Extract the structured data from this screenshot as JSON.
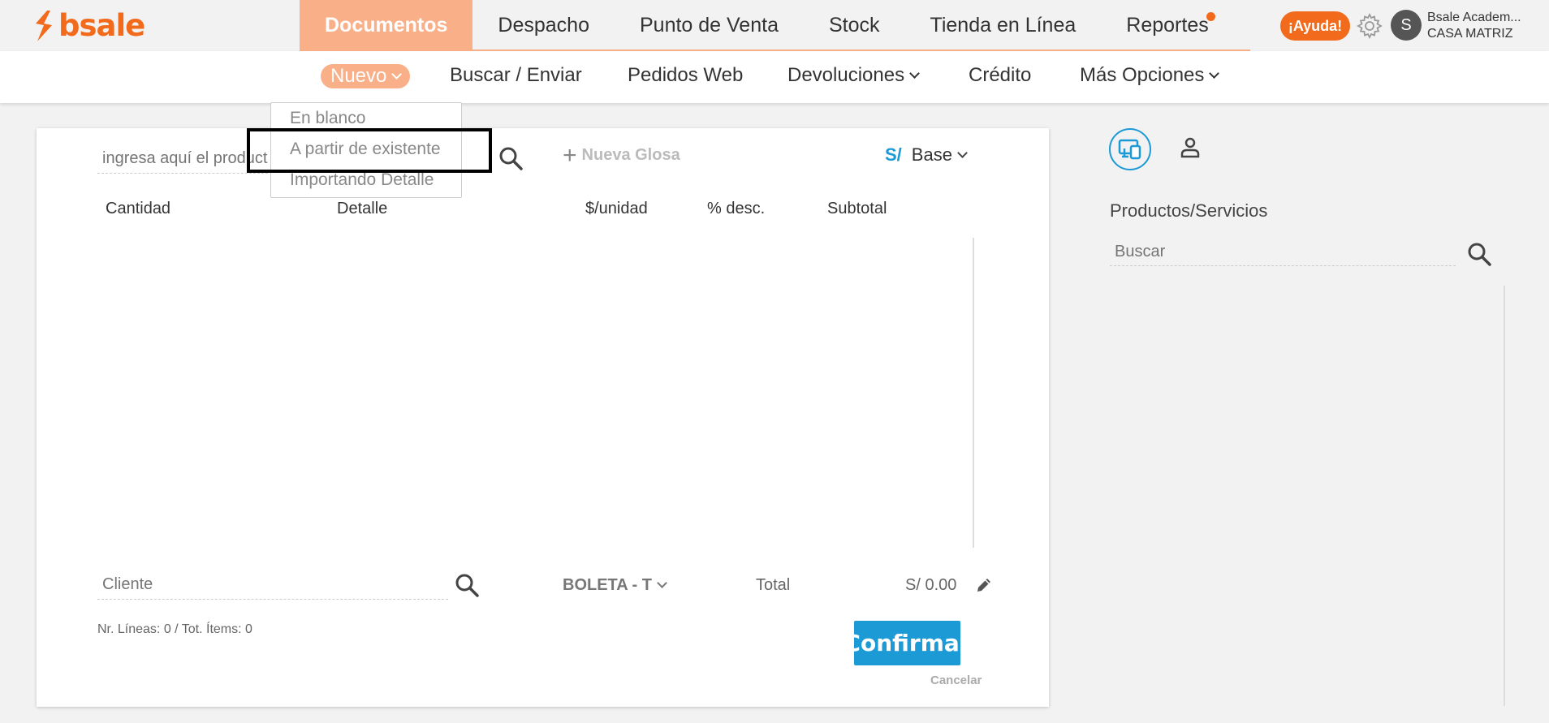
{
  "brand": {
    "logo_text": "bsale",
    "color": "#f26b1d"
  },
  "main_nav": [
    {
      "label": "Documentos",
      "active": true
    },
    {
      "label": "Despacho"
    },
    {
      "label": "Punto de Venta"
    },
    {
      "label": "Stock"
    },
    {
      "label": "Tienda en Línea"
    },
    {
      "label": "Reportes",
      "notification": true
    }
  ],
  "header": {
    "help_label": "¡Ayuda!",
    "avatar_initial": "S",
    "user_name": "Bsale Academ...",
    "branch": "CASA MATRIZ"
  },
  "sub_nav": {
    "nuevo": "Nuevo",
    "buscar": "Buscar / Enviar",
    "pedidos": "Pedidos Web",
    "devoluciones": "Devoluciones",
    "credito": "Crédito",
    "mas": "Más Opciones"
  },
  "dropdown": {
    "options": [
      "En blanco",
      "A partir de existente",
      "Importando Detalle"
    ]
  },
  "document": {
    "product_placeholder": "ingresa aquí el producto",
    "nueva_glosa": "Nueva Glosa",
    "currency_symbol": "S/",
    "price_list": "Base",
    "columns": {
      "cantidad": "Cantidad",
      "detalle": "Detalle",
      "unidad": "$/unidad",
      "desc": "% desc.",
      "subtotal": "Subtotal"
    },
    "cliente_placeholder": "Cliente",
    "doc_type": "BOLETA - T",
    "total_label": "Total",
    "total_value": "S/ 0.00",
    "lines_info": "Nr. Líneas: 0 / Tot. Ítems: 0",
    "confirm": "Confirmar",
    "cancel": "Cancelar"
  },
  "right_panel": {
    "title": "Productos/Servicios",
    "search_placeholder": "Buscar"
  },
  "colors": {
    "accent": "#f9b089",
    "brand": "#f26b1d",
    "primary": "#1b9ad6"
  }
}
